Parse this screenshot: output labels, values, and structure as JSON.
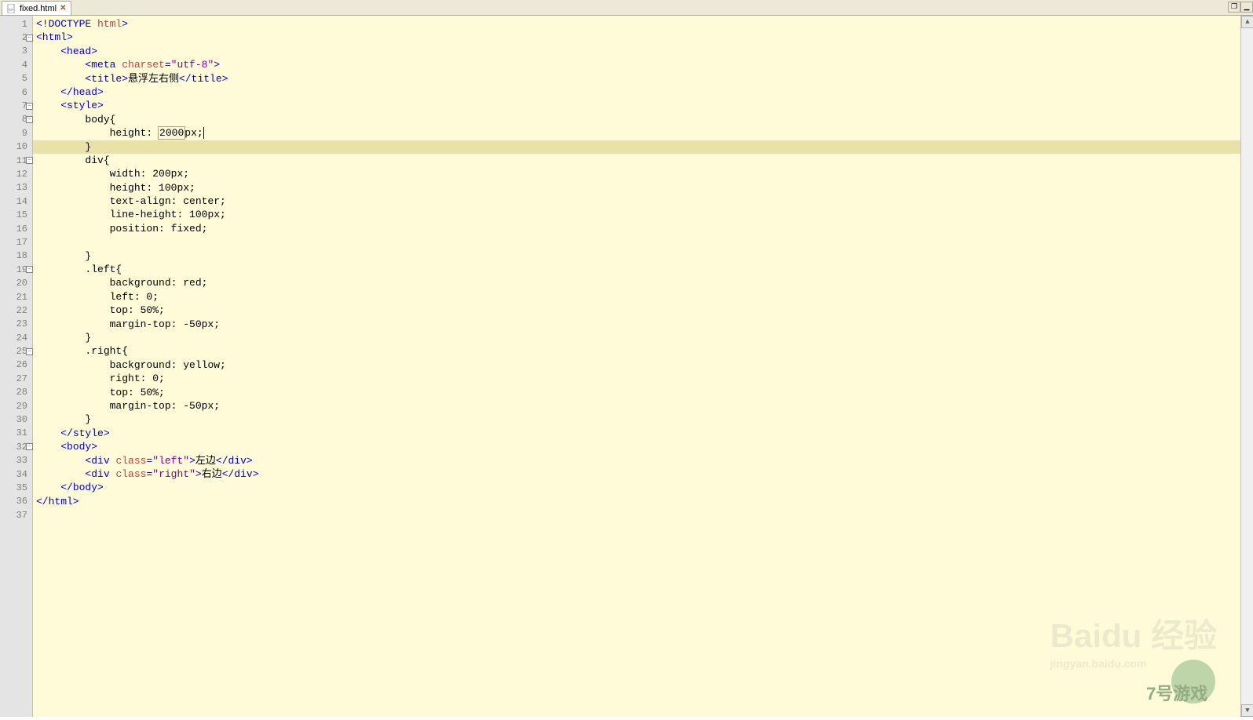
{
  "tab": {
    "filename": "fixed.html",
    "close": "✕"
  },
  "windowControls": {
    "restore": "❐",
    "minimize": "▁"
  },
  "gutter": {
    "lines": 37,
    "foldable": [
      2,
      7,
      8,
      11,
      19,
      25,
      32
    ]
  },
  "code": [
    {
      "n": 1,
      "ind": 0,
      "segs": [
        [
          "tag",
          "<!DOCTYPE "
        ],
        [
          "attr-name",
          "html"
        ],
        [
          "tag",
          ">"
        ]
      ]
    },
    {
      "n": 2,
      "ind": 0,
      "segs": [
        [
          "tag",
          "<html>"
        ]
      ]
    },
    {
      "n": 3,
      "ind": 1,
      "segs": [
        [
          "tag",
          "<head>"
        ]
      ]
    },
    {
      "n": 4,
      "ind": 2,
      "segs": [
        [
          "tag",
          "<meta "
        ],
        [
          "attr-name",
          "charset"
        ],
        [
          "tag",
          "="
        ],
        [
          "attr-value",
          "\"utf-8\""
        ],
        [
          "tag",
          ">"
        ]
      ]
    },
    {
      "n": 5,
      "ind": 2,
      "segs": [
        [
          "tag",
          "<title>"
        ],
        [
          "plain",
          "悬浮左右侧"
        ],
        [
          "tag",
          "</title>"
        ]
      ]
    },
    {
      "n": 6,
      "ind": 1,
      "segs": [
        [
          "tag",
          "</head>"
        ]
      ]
    },
    {
      "n": 7,
      "ind": 1,
      "segs": [
        [
          "tag",
          "<style>"
        ]
      ]
    },
    {
      "n": 8,
      "ind": 2,
      "segs": [
        [
          "plain",
          "body{"
        ]
      ]
    },
    {
      "n": 9,
      "ind": 3,
      "segs": [
        [
          "plain",
          "height: "
        ],
        [
          "num",
          "2000"
        ],
        [
          "plain",
          "px;"
        ]
      ],
      "cursor": true
    },
    {
      "n": 10,
      "ind": 2,
      "segs": [
        [
          "plain",
          "}"
        ]
      ],
      "hl": true
    },
    {
      "n": 11,
      "ind": 2,
      "segs": [
        [
          "plain",
          "div{"
        ]
      ]
    },
    {
      "n": 12,
      "ind": 3,
      "segs": [
        [
          "plain",
          "width: 200px;"
        ]
      ]
    },
    {
      "n": 13,
      "ind": 3,
      "segs": [
        [
          "plain",
          "height: 100px;"
        ]
      ]
    },
    {
      "n": 14,
      "ind": 3,
      "segs": [
        [
          "plain",
          "text-align: center;"
        ]
      ]
    },
    {
      "n": 15,
      "ind": 3,
      "segs": [
        [
          "plain",
          "line-height: 100px;"
        ]
      ]
    },
    {
      "n": 16,
      "ind": 3,
      "segs": [
        [
          "plain",
          "position: fixed;"
        ]
      ]
    },
    {
      "n": 17,
      "ind": 3,
      "segs": []
    },
    {
      "n": 18,
      "ind": 2,
      "segs": [
        [
          "plain",
          "}"
        ]
      ]
    },
    {
      "n": 19,
      "ind": 2,
      "segs": [
        [
          "plain",
          ".left{"
        ]
      ]
    },
    {
      "n": 20,
      "ind": 3,
      "segs": [
        [
          "plain",
          "background: red;"
        ]
      ]
    },
    {
      "n": 21,
      "ind": 3,
      "segs": [
        [
          "plain",
          "left: 0;"
        ]
      ]
    },
    {
      "n": 22,
      "ind": 3,
      "segs": [
        [
          "plain",
          "top: 50%;"
        ]
      ]
    },
    {
      "n": 23,
      "ind": 3,
      "segs": [
        [
          "plain",
          "margin-top: -50px;"
        ]
      ]
    },
    {
      "n": 24,
      "ind": 2,
      "segs": [
        [
          "plain",
          "}"
        ]
      ]
    },
    {
      "n": 25,
      "ind": 2,
      "segs": [
        [
          "plain",
          ".right{"
        ]
      ]
    },
    {
      "n": 26,
      "ind": 3,
      "segs": [
        [
          "plain",
          "background: yellow;"
        ]
      ]
    },
    {
      "n": 27,
      "ind": 3,
      "segs": [
        [
          "plain",
          "right: 0;"
        ]
      ]
    },
    {
      "n": 28,
      "ind": 3,
      "segs": [
        [
          "plain",
          "top: 50%;"
        ]
      ]
    },
    {
      "n": 29,
      "ind": 3,
      "segs": [
        [
          "plain",
          "margin-top: -50px;"
        ]
      ]
    },
    {
      "n": 30,
      "ind": 2,
      "segs": [
        [
          "plain",
          "}"
        ]
      ]
    },
    {
      "n": 31,
      "ind": 1,
      "segs": [
        [
          "tag",
          "</style>"
        ]
      ]
    },
    {
      "n": 32,
      "ind": 1,
      "segs": [
        [
          "tag",
          "<body>"
        ]
      ]
    },
    {
      "n": 33,
      "ind": 2,
      "segs": [
        [
          "tag",
          "<div "
        ],
        [
          "attr-name",
          "class"
        ],
        [
          "tag",
          "="
        ],
        [
          "attr-value",
          "\"left\""
        ],
        [
          "tag",
          ">"
        ],
        [
          "plain",
          "左边"
        ],
        [
          "tag",
          "</div>"
        ]
      ]
    },
    {
      "n": 34,
      "ind": 2,
      "segs": [
        [
          "tag",
          "<div "
        ],
        [
          "attr-name",
          "class"
        ],
        [
          "tag",
          "="
        ],
        [
          "attr-value",
          "\"right\""
        ],
        [
          "tag",
          ">"
        ],
        [
          "plain",
          "右边"
        ],
        [
          "tag",
          "</div>"
        ]
      ]
    },
    {
      "n": 35,
      "ind": 1,
      "segs": [
        [
          "tag",
          "</body>"
        ]
      ]
    },
    {
      "n": 36,
      "ind": 0,
      "segs": [
        [
          "tag",
          "</html>"
        ]
      ]
    },
    {
      "n": 37,
      "ind": 0,
      "segs": []
    }
  ],
  "watermark": {
    "brand": "Baidu 经验",
    "url": "jingyan.baidu.com",
    "secondary": "7号游戏"
  }
}
